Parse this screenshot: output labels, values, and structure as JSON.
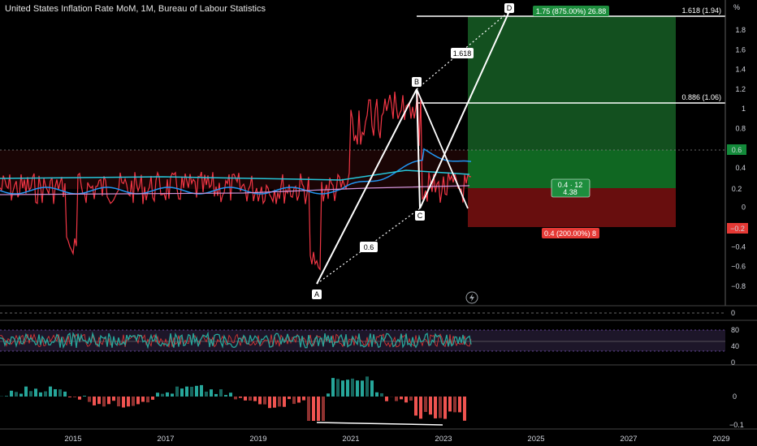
{
  "title": "United States Inflation Rate MoM, 1M, Bureau of Labour Statistics",
  "unit": "%",
  "price_axis": [
    "1.8",
    "1.6",
    "1.4",
    "1.2",
    "1",
    "0.8",
    "0.6",
    "0.4",
    "0.2",
    "0",
    "−0.2",
    "−0.4",
    "−0.6",
    "−0.8"
  ],
  "x_axis": [
    "2015",
    "2017",
    "2019",
    "2021",
    "2023",
    "2025",
    "2027",
    "2029"
  ],
  "pattern_points": {
    "A": "A",
    "B": "B",
    "C": "C",
    "D": "D"
  },
  "ratios": {
    "xb": "0.6",
    "bd": "1.618"
  },
  "fib_labels": {
    "top": "1.618 (1.94)",
    "mid": "0.886 (1.06)"
  },
  "position": {
    "target_label": "1.75 (875.00%) 26.88",
    "center_label": "0.4 · 12",
    "center_sub": "4.38",
    "stop_label": "0.4 (200.00%) 8"
  },
  "price_badges": {
    "last": "0.6",
    "entry": "0.2",
    "stop": "−0.2"
  },
  "pane2_axis": [
    "0"
  ],
  "rsi_axis": [
    "80",
    "40",
    "0"
  ],
  "macd_axis": [
    "0",
    "−0.1"
  ],
  "colors": {
    "price": "#f23645",
    "ma_fast": "#2196f3",
    "ma_slow": "#26c6da",
    "ma_long": "#ce93d8",
    "rsi": "#26a69a",
    "up": "#26a69a",
    "down": "#ef5350",
    "target": "#1e7f2e",
    "stop": "#7a1111"
  }
}
